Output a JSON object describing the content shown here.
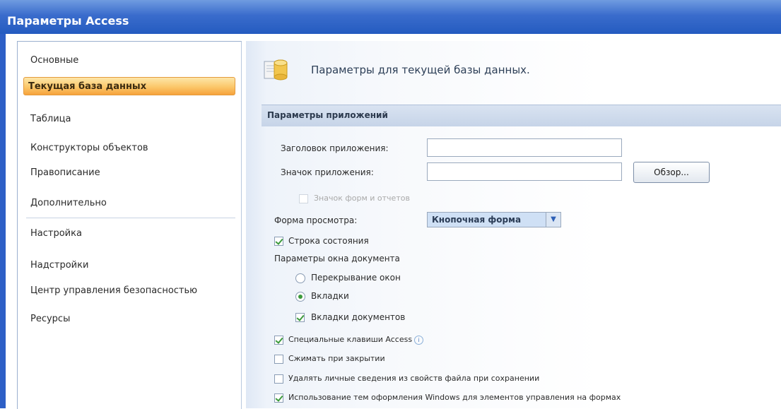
{
  "window": {
    "title": "Параметры Access"
  },
  "sidebar": {
    "items": [
      {
        "label": "Основные"
      },
      {
        "label": "Текущая база данных"
      },
      {
        "label": "Таблица"
      },
      {
        "label": "Конструкторы объектов"
      },
      {
        "label": "Правописание"
      },
      {
        "label": "Дополнительно"
      },
      {
        "label": "Настройка"
      },
      {
        "label": "Надстройки"
      },
      {
        "label": "Центр управления безопасностью"
      },
      {
        "label": "Ресурсы"
      }
    ],
    "active_index": 1
  },
  "header": {
    "text": "Параметры для текущей базы данных."
  },
  "section": {
    "title": "Параметры приложений"
  },
  "form": {
    "app_title_label": "Заголовок приложения:",
    "app_title_value": "",
    "app_icon_label": "Значок приложения:",
    "app_icon_value": "",
    "browse_button": "Обзор...",
    "forms_reports_icon_label": "Значок форм и отчетов",
    "forms_reports_icon_checked": false,
    "display_form_label": "Форма просмотра:",
    "display_form_value": "Кнопочная форма",
    "status_bar_label": "Строка состояния",
    "status_bar_checked": true,
    "doc_window_options_label": "Параметры окна документа",
    "overlapping_windows_label": "Перекрывание окон",
    "overlapping_windows_selected": false,
    "tabbed_docs_label": "Вкладки",
    "tabbed_docs_selected": true,
    "doc_tabs_label": "Вкладки документов",
    "doc_tabs_checked": true,
    "special_keys_label": "Специальные клавиши Access",
    "special_keys_checked": true,
    "special_keys_info_icon": "info-icon",
    "compact_on_close_label": "Сжимать при закрытии",
    "compact_on_close_checked": false,
    "remove_personal_label": "Удалять личные сведения из свойств файла при сохранении",
    "remove_personal_checked": false,
    "windows_themes_label": "Использование тем оформления Windows для элементов управления на формах",
    "windows_themes_checked": true
  },
  "colors": {
    "titlebar": "#245bc0",
    "active_item": "#f6a23c",
    "check_mark": "#3b9a3b"
  }
}
